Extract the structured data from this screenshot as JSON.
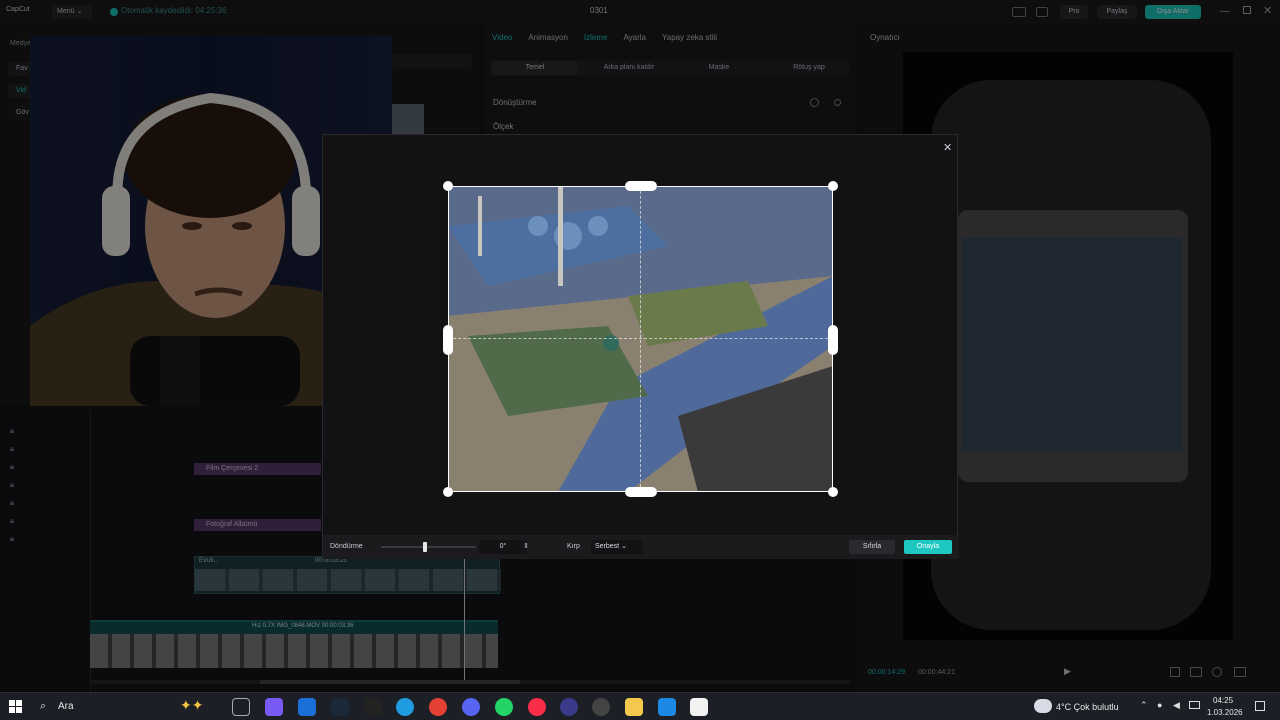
{
  "app": {
    "logo": "CapCut",
    "menu_label": "Menü",
    "save_status": "Otomatik kaydedildi: 04:25:36",
    "project_name": "0301",
    "pro_label": "Pro",
    "share_label": "Paylaş",
    "export_label": "Dışa Aktar"
  },
  "left_toolbar": {
    "media_label": "Medya",
    "sidebar_items": [
      "Fav",
      "Vid",
      "Göv"
    ]
  },
  "inspector": {
    "tabs": [
      "Video",
      "Animasyon",
      "İzleme",
      "Ayarla",
      "Yapay zeka stili"
    ],
    "active_tab": "Video",
    "subtabs": [
      "Temel",
      "Arka planı kaldır",
      "Maske",
      "Rötuş yap"
    ],
    "transform_label": "Dönüştürme",
    "scale_label": "Ölçek"
  },
  "player": {
    "title": "Oynatıcı",
    "time_current": "00:00:14:29",
    "time_total": "00:00:44:21"
  },
  "crop_dialog": {
    "close_icon": "close-icon",
    "rotation_label": "Döndürme",
    "rotation_value": "0°",
    "crop_label": "Kırp",
    "crop_mode": "Serbest",
    "reset_label": "Sıfırla",
    "confirm_label": "Onayla"
  },
  "timeline": {
    "clips": {
      "film_frame": "Film Çerçevesi 2",
      "photo_album": "Fotoğraf Albümü",
      "main_track_label": "EVu9...",
      "main_track_duration": "00:00:03:23",
      "main_clip": "Hız 0.7X  IMG_0846.MOV  00:00:03:36"
    }
  },
  "taskbar": {
    "search_label": "Ara",
    "weather": "4°C  Çok bulutlu",
    "time": "04:25",
    "date": "1.03.2026"
  },
  "colors": {
    "accent": "#1ec8c0",
    "clip_purple": "#5a3a6a",
    "clip_teal": "#0f4a4a"
  }
}
